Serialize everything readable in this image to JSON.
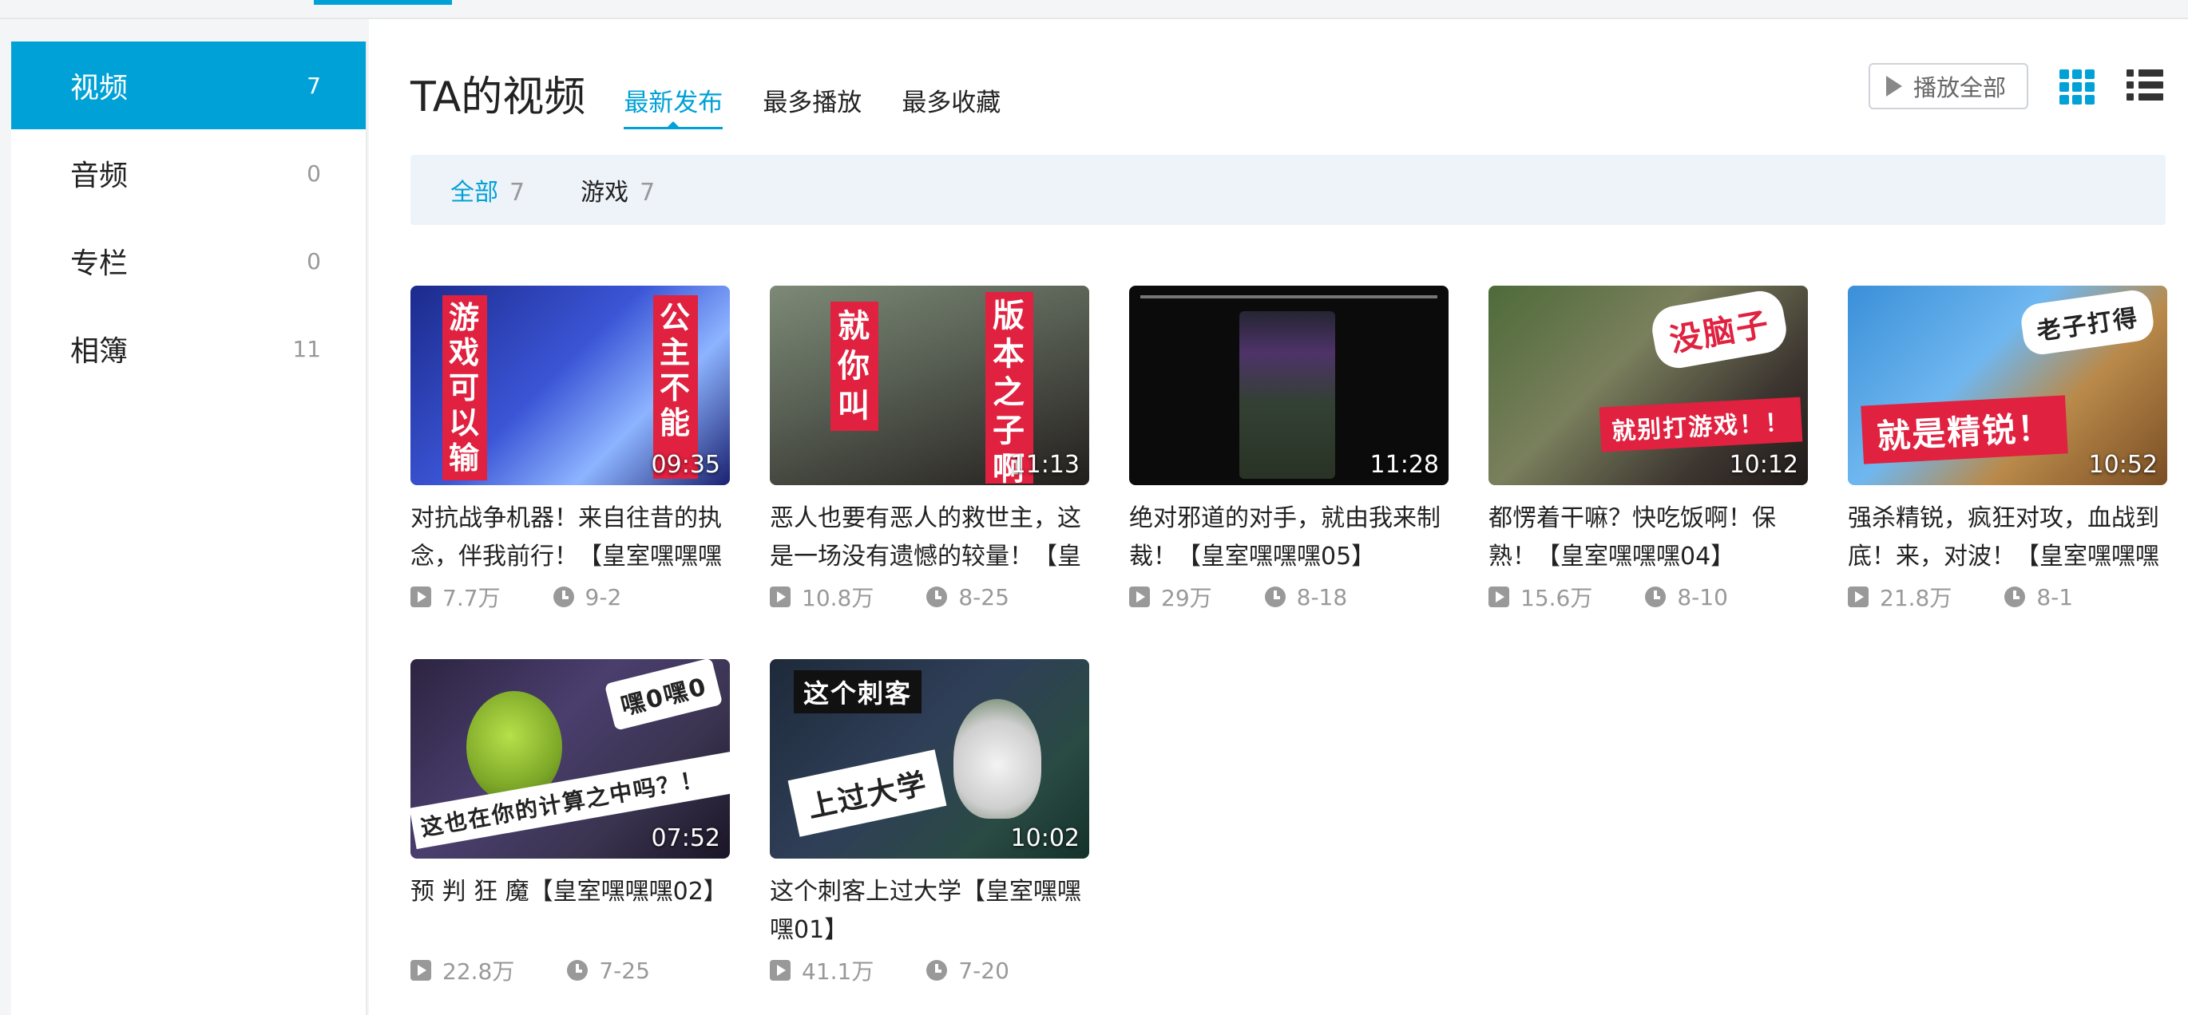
{
  "sidebar": {
    "items": [
      {
        "label": "视频",
        "count": "7"
      },
      {
        "label": "音频",
        "count": "0"
      },
      {
        "label": "专栏",
        "count": "0"
      },
      {
        "label": "相簿",
        "count": "11"
      }
    ]
  },
  "header": {
    "title": "TA的视频",
    "tabs": [
      "最新发布",
      "最多播放",
      "最多收藏"
    ],
    "play_all": "播放全部"
  },
  "filters": [
    {
      "label": "全部",
      "count": "7"
    },
    {
      "label": "游戏",
      "count": "7"
    }
  ],
  "videos": [
    {
      "title": "对抗战争机器！来自往昔的执念，伴我前行！【皇室嘿嘿嘿",
      "duration": "09:35",
      "plays": "7.7万",
      "date": "9-2",
      "caption_a": "游戏可以输",
      "caption_b": "公主不能"
    },
    {
      "title": "恶人也要有恶人的救世主，这是一场没有遗憾的较量！【皇",
      "duration": "11:13",
      "plays": "10.8万",
      "date": "8-25",
      "caption_a": "就你叫",
      "caption_b": "版本之子啊"
    },
    {
      "title": "绝对邪道的对手，就由我来制裁！【皇室嘿嘿嘿05】",
      "duration": "11:28",
      "plays": "29万",
      "date": "8-18"
    },
    {
      "title": "都愣着干嘛？快吃饭啊！保熟！【皇室嘿嘿嘿04】",
      "duration": "10:12",
      "plays": "15.6万",
      "date": "8-10",
      "caption_a": "没脑子",
      "caption_b": "就别打游戏！！"
    },
    {
      "title": "强杀精锐，疯狂对攻，血战到底！来，对波！【皇室嘿嘿嘿",
      "duration": "10:52",
      "plays": "21.8万",
      "date": "8-1",
      "caption_a": "老子打得",
      "caption_b": "就是精锐！"
    },
    {
      "title": "预 判 狂 魔【皇室嘿嘿嘿02】",
      "duration": "07:52",
      "plays": "22.8万",
      "date": "7-25",
      "caption_a": "嘿0嘿0",
      "caption_b": "这也在你的计算之中吗？！"
    },
    {
      "title": "这个刺客上过大学【皇室嘿嘿嘿01】",
      "duration": "10:02",
      "plays": "41.1万",
      "date": "7-20",
      "caption_a": "这个刺客",
      "caption_b": "上过大学"
    }
  ],
  "colors": {
    "accent": "#00a1d6",
    "filter_bg": "#eef3f9",
    "muted": "#999999"
  }
}
